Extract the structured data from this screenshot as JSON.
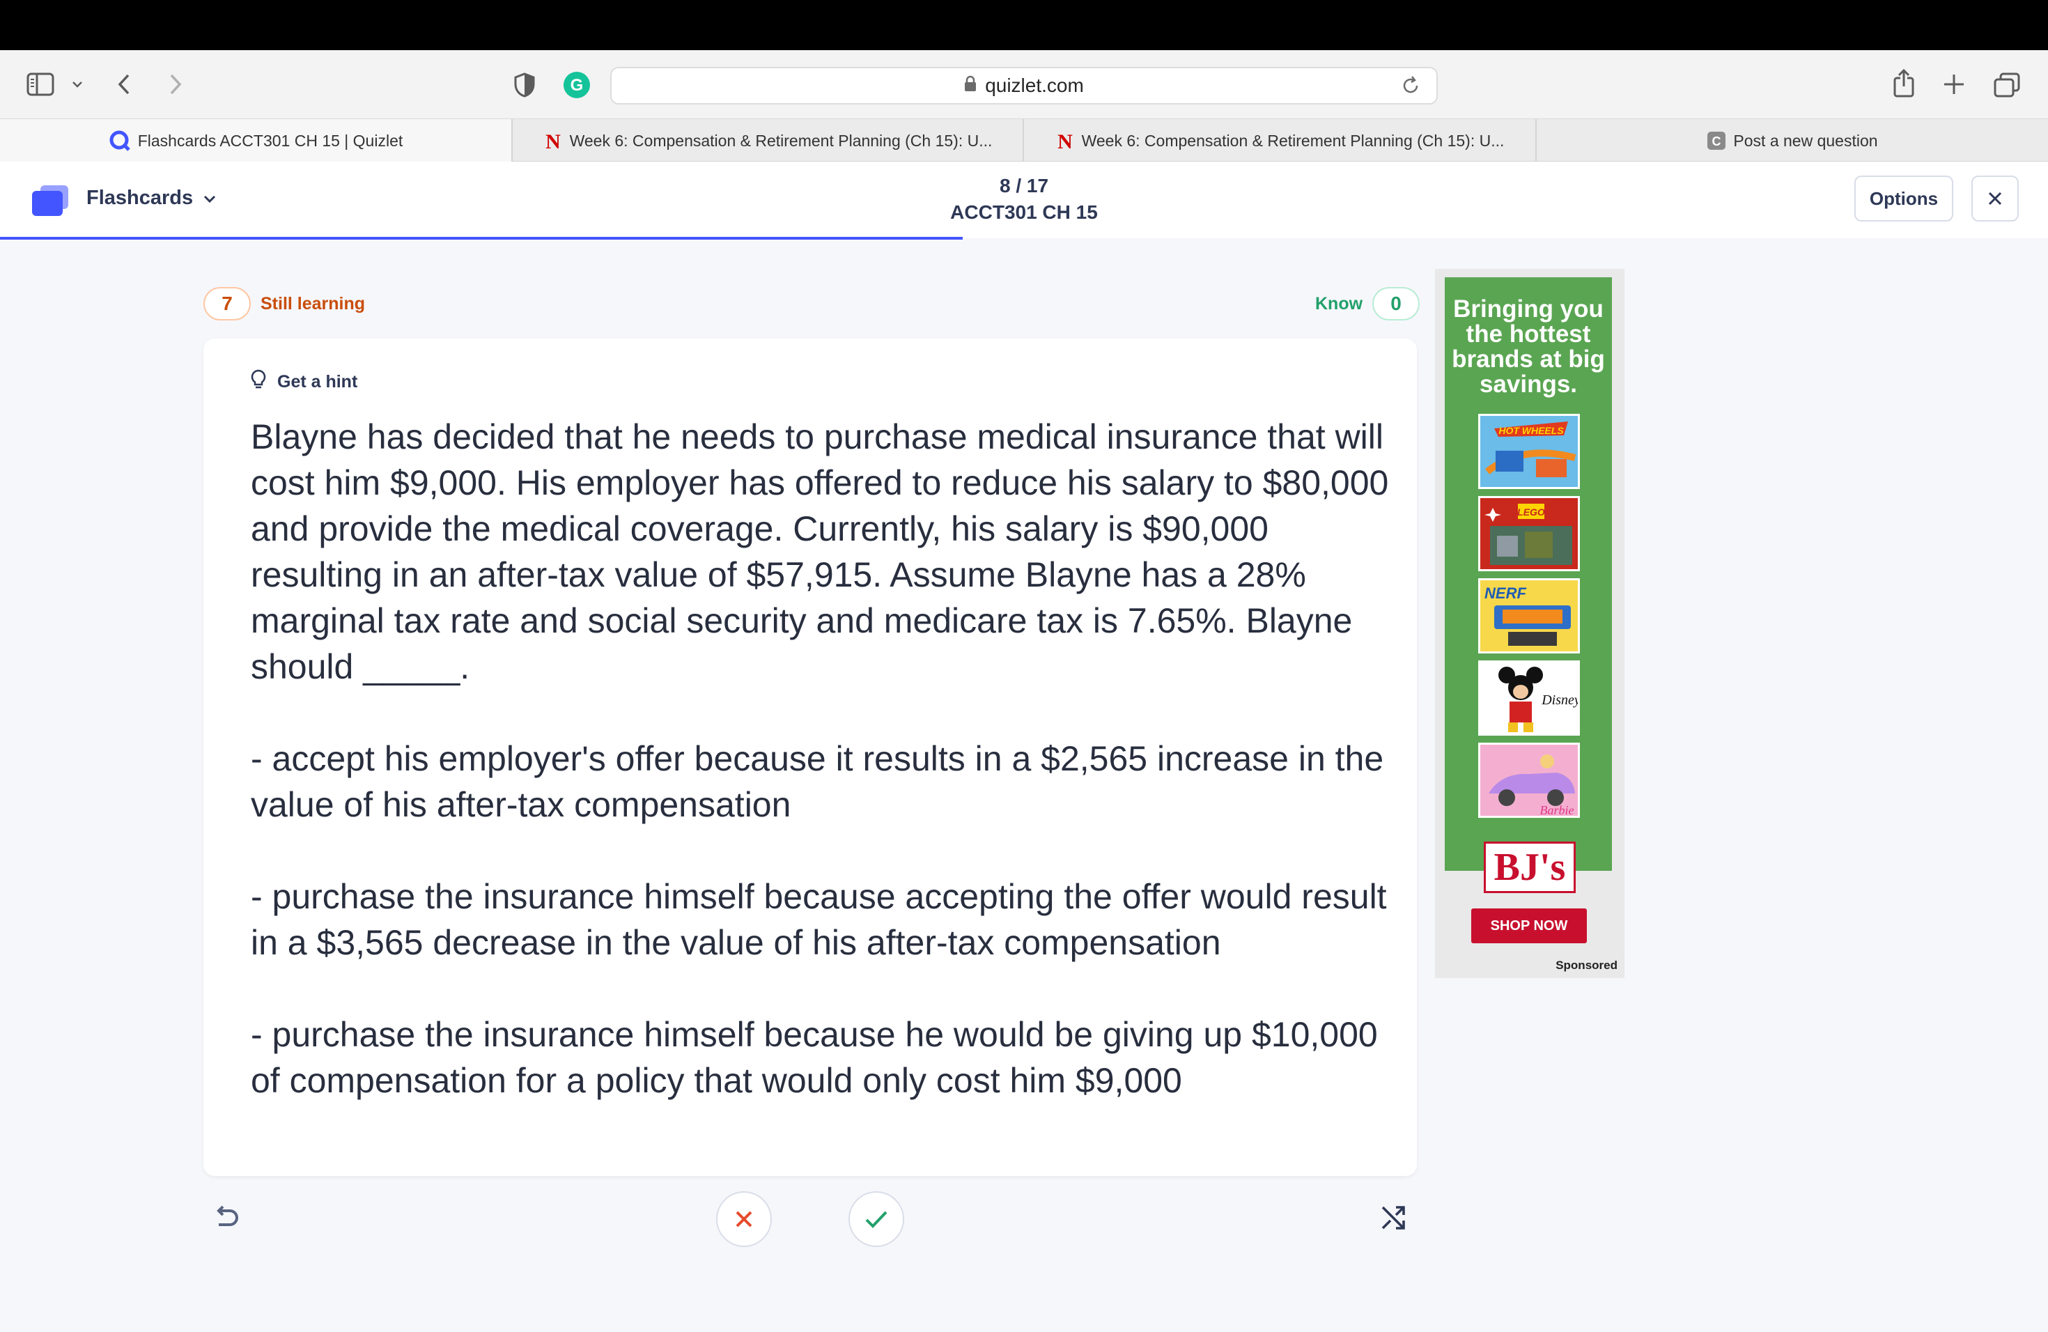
{
  "browser": {
    "url": "quizlet.com",
    "tabs": [
      {
        "label": "Flashcards ACCT301 CH 15 | Quizlet",
        "favicon": "quizlet-q"
      },
      {
        "label": "Week 6: Compensation & Retirement Planning (Ch 15): U...",
        "favicon": "nebraska-n"
      },
      {
        "label": "Week 6: Compensation & Retirement Planning (Ch 15): U...",
        "favicon": "nebraska-n"
      },
      {
        "label": "Post a new question",
        "favicon": "chegg-c"
      }
    ]
  },
  "header": {
    "mode_label": "Flashcards",
    "progress": "8 / 17",
    "progress_fraction": 0.47,
    "set_title": "ACCT301 CH 15",
    "options_label": "Options"
  },
  "counters": {
    "still_learning_count": "7",
    "still_learning_label": "Still learning",
    "know_label": "Know",
    "know_count": "0"
  },
  "card": {
    "hint_label": "Get a hint",
    "paragraphs": [
      "Blayne has decided that he needs to purchase medical insurance that will cost him $9,000. His employer has offered to reduce his salary to $80,000 and provide the medical coverage. Currently, his salary is $90,000 resulting in an after-tax value of $57,915. Assume Blayne has a 28% marginal tax rate and social security and medicare tax is 7.65%. Blayne should _____.",
      "- accept his employer's offer because it results in a $2,565 increase in the value of his after-tax compensation",
      "- purchase the insurance himself because accepting the offer would result in a $3,565 decrease in the value of his after-tax compensation",
      "- purchase the insurance himself because he would be giving up $10,000 of compensation for a policy that would only cost him $9,000"
    ]
  },
  "ad": {
    "headline": "Bringing you the hottest brands at big savings.",
    "logo_text": "BJ's",
    "cta": "SHOP NOW",
    "sponsored": "Sponsored",
    "tiles": [
      "HOT WHEELS",
      "LEGO",
      "NERF",
      "Disney",
      "Barbie"
    ]
  },
  "colors": {
    "accent": "#4255ff",
    "still_learning": "#c94e0b",
    "know": "#23a06b",
    "ad_green": "#5aa552",
    "bj_red": "#c8102e"
  }
}
